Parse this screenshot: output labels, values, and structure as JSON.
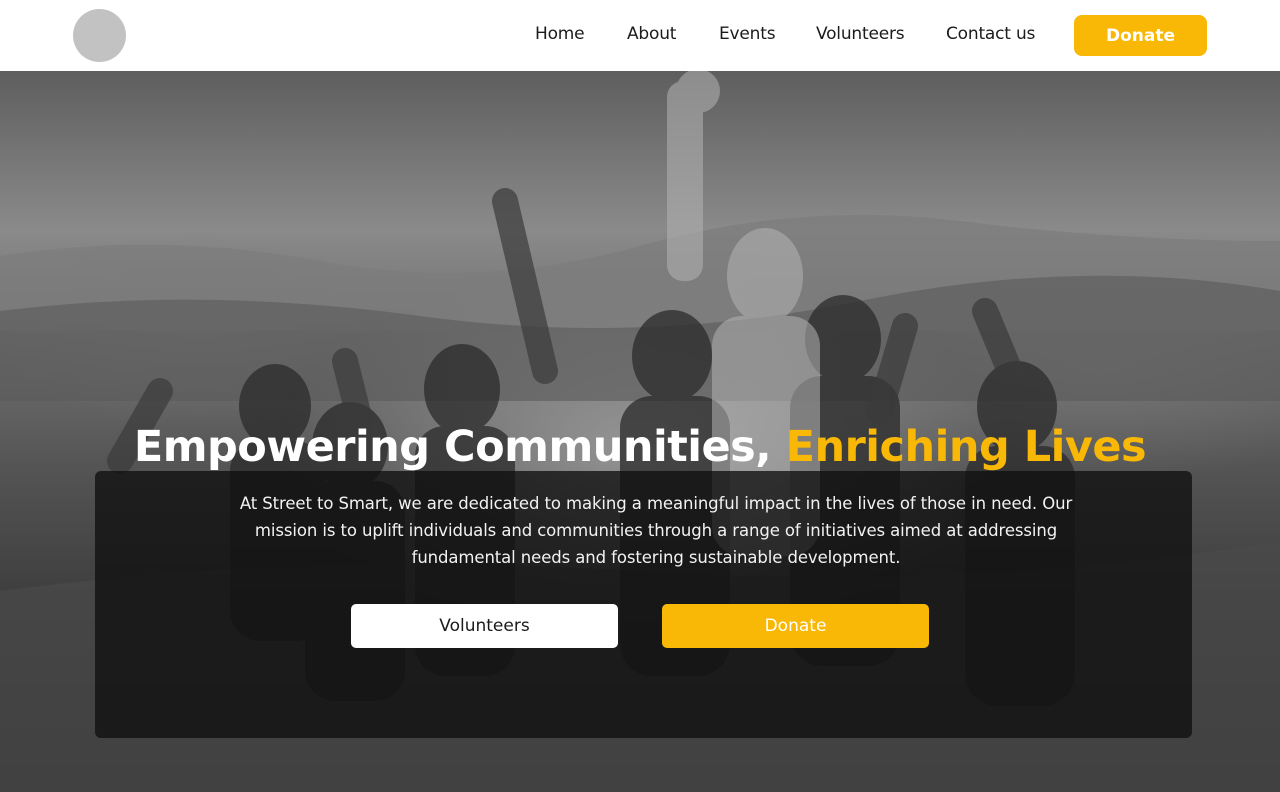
{
  "header": {
    "nav": [
      {
        "label": "Home"
      },
      {
        "label": "About"
      },
      {
        "label": "Events"
      },
      {
        "label": "Volunteers"
      },
      {
        "label": "Contact us"
      }
    ],
    "donate_label": "Donate"
  },
  "hero": {
    "headline_main": "Empowering Communities,",
    "headline_accent": "Enriching Lives",
    "intro": "At Street to Smart, we are dedicated to making a meaningful impact in the lives of those in need. Our mission is to uplift individuals and communities through a range of initiatives aimed at addressing fundamental needs and fostering sustainable development.",
    "volunteers_label": "Volunteers",
    "donate_label": "Donate"
  },
  "colors": {
    "accent": "#f8b805",
    "logo_placeholder": "#c2c2c2",
    "overlay": "#0f0f0f"
  }
}
